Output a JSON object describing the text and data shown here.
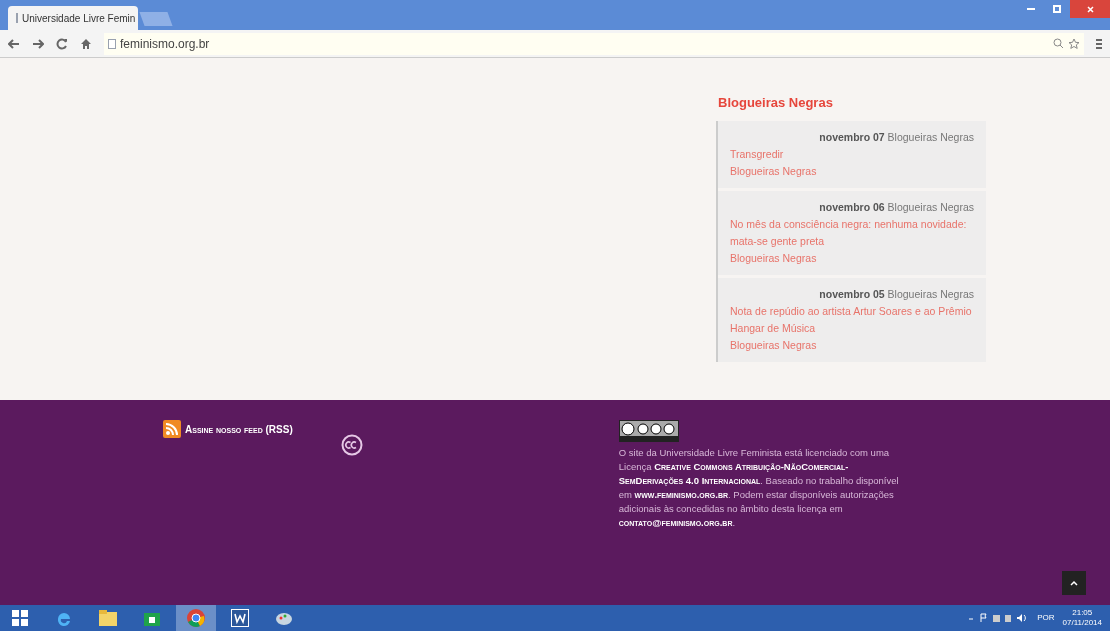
{
  "browser": {
    "tab_title": "Universidade Livre Femin",
    "url": "feminismo.org.br"
  },
  "sidebar": {
    "title": "Blogueiras Negras",
    "posts": [
      {
        "date": "novembro 07",
        "source": "Blogueiras Negras",
        "title": "Transgredir",
        "link": "Blogueiras Negras"
      },
      {
        "date": "novembro 06",
        "source": "Blogueiras Negras",
        "title": "No mês da consciência negra: nenhuma novidade: mata-se gente preta",
        "link": "Blogueiras Negras"
      },
      {
        "date": "novembro 05",
        "source": "Blogueiras Negras",
        "title": "Nota de repúdio ao artista Artur Soares e ao Prêmio Hangar de Música",
        "link": "Blogueiras Negras"
      }
    ]
  },
  "footer": {
    "rss": "Assine nosso feed (RSS)",
    "license": "O site da Universidade Livre Feminista  está licenciado com uma Licença **Creative Commons Atribuição-NãoComercial-SemDerivações 4.0 Internacional**. Baseado no trabalho disponível em **www.feminismo.org.br**. Podem estar disponíveis autorizações adicionais às concedidas no âmbito desta licença em **contato@feminismo.org.br**."
  },
  "taskbar": {
    "apps": [
      {
        "kind": "ie",
        "selected": false
      },
      {
        "kind": "explorer",
        "selected": false
      },
      {
        "kind": "store",
        "selected": false
      },
      {
        "kind": "chrome",
        "selected": true
      },
      {
        "kind": "word",
        "selected": false
      },
      {
        "kind": "paint",
        "selected": false
      }
    ],
    "language": "POR",
    "time": "21:05",
    "date": "07/11/2014"
  }
}
